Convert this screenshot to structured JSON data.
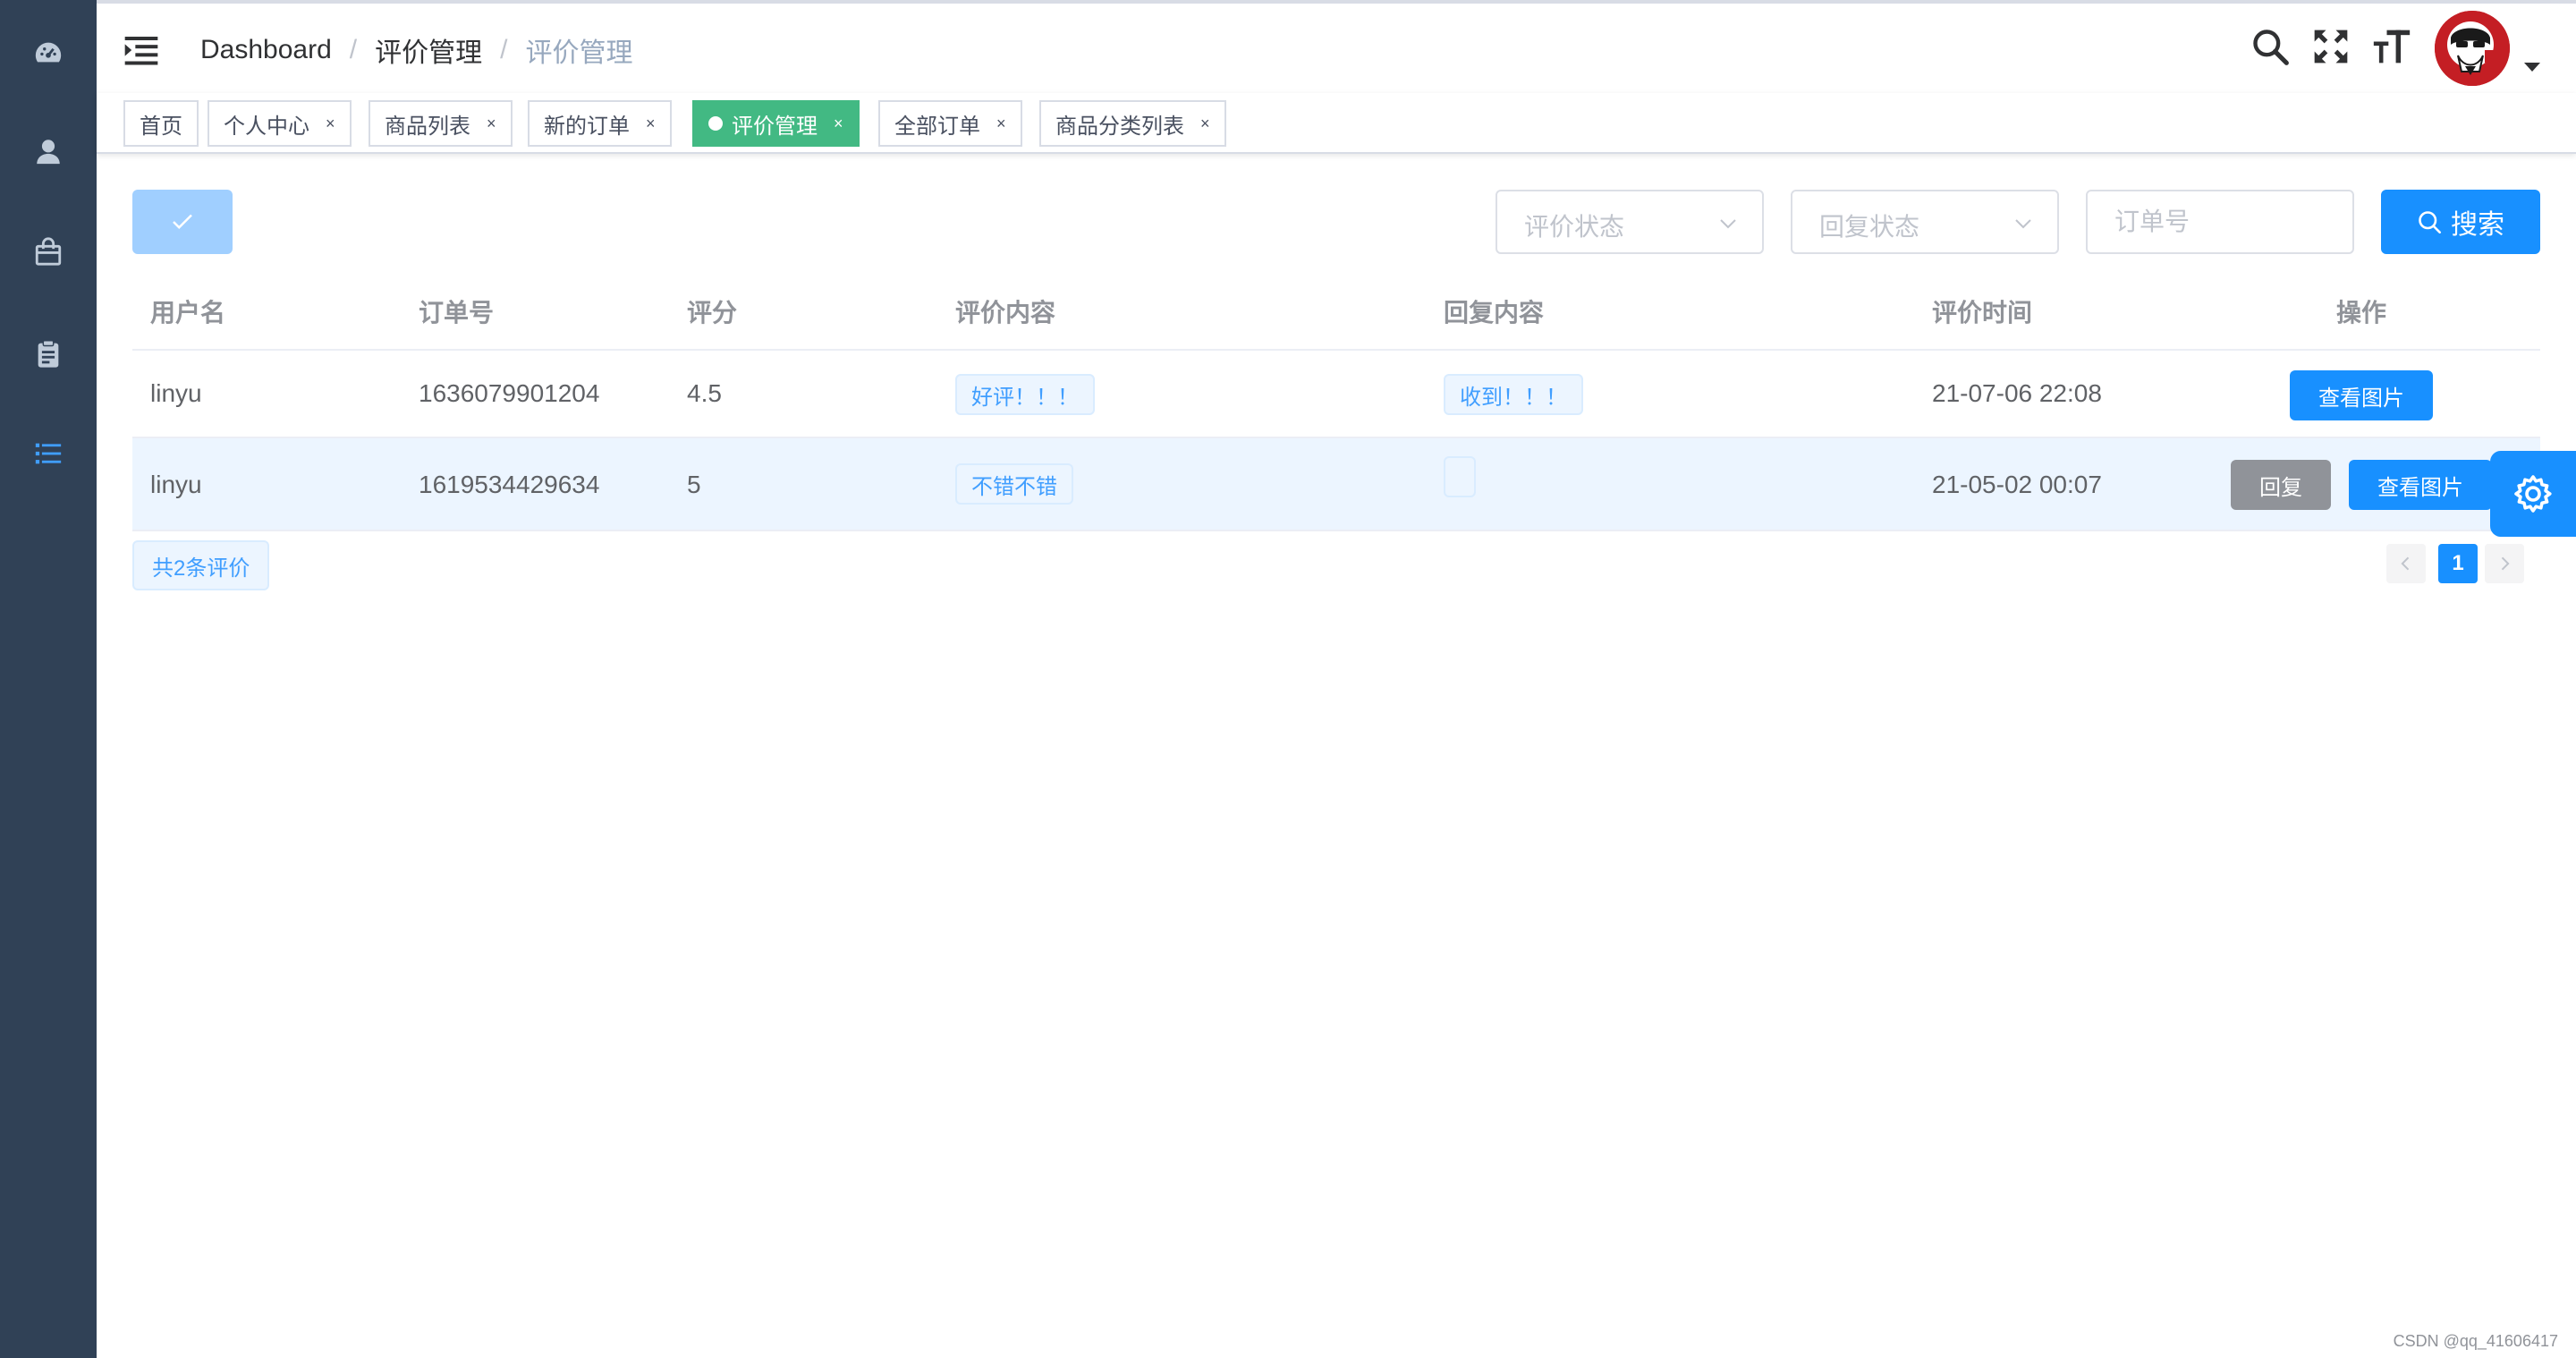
{
  "breadcrumb": {
    "home": "Dashboard",
    "section": "评价管理",
    "current": "评价管理"
  },
  "tags": [
    {
      "label": "首页",
      "closable": false,
      "active": false
    },
    {
      "label": "个人中心",
      "closable": true,
      "active": false
    },
    {
      "label": "商品列表",
      "closable": true,
      "active": false
    },
    {
      "label": "新的订单",
      "closable": true,
      "active": false
    },
    {
      "label": "评价管理",
      "closable": true,
      "active": true
    },
    {
      "label": "全部订单",
      "closable": true,
      "active": false
    },
    {
      "label": "商品分类列表",
      "closable": true,
      "active": false
    }
  ],
  "tag_close_glyph": "×",
  "filters": {
    "review_status_placeholder": "评价状态",
    "reply_status_placeholder": "回复状态",
    "order_no_placeholder": "订单号",
    "search_label": "搜索"
  },
  "table": {
    "columns": [
      "用户名",
      "订单号",
      "评分",
      "评价内容",
      "回复内容",
      "评价时间",
      "操作"
    ],
    "rows": [
      {
        "username": "linyu",
        "order_no": "1636079901204",
        "score": "4.5",
        "content": "好评！！！",
        "reply": "收到！！！",
        "time": "21-07-06 22:08"
      },
      {
        "username": "linyu",
        "order_no": "1619534429634",
        "score": "5",
        "content": "不错不错",
        "reply": "",
        "time": "21-05-02 00:07"
      }
    ],
    "actions": {
      "reply": "回复",
      "view_images": "查看图片"
    }
  },
  "footer": {
    "total": "共2条评价",
    "current_page": "1"
  },
  "watermark": "CSDN @qq_41606417",
  "colors": {
    "sidebar_bg": "#304156",
    "primary": "#1890ff",
    "active_tag": "#42b983",
    "active_menu": "#409eff"
  },
  "icons": {
    "sidebar": [
      "dashboard-icon",
      "user-icon",
      "shopping-bag-icon",
      "clipboard-icon",
      "list-icon"
    ],
    "navbar": [
      "hamburger-icon",
      "search-icon",
      "fullscreen-icon",
      "font-size-icon",
      "avatar",
      "caret-down-icon"
    ],
    "floating": "settings-gear-icon"
  }
}
